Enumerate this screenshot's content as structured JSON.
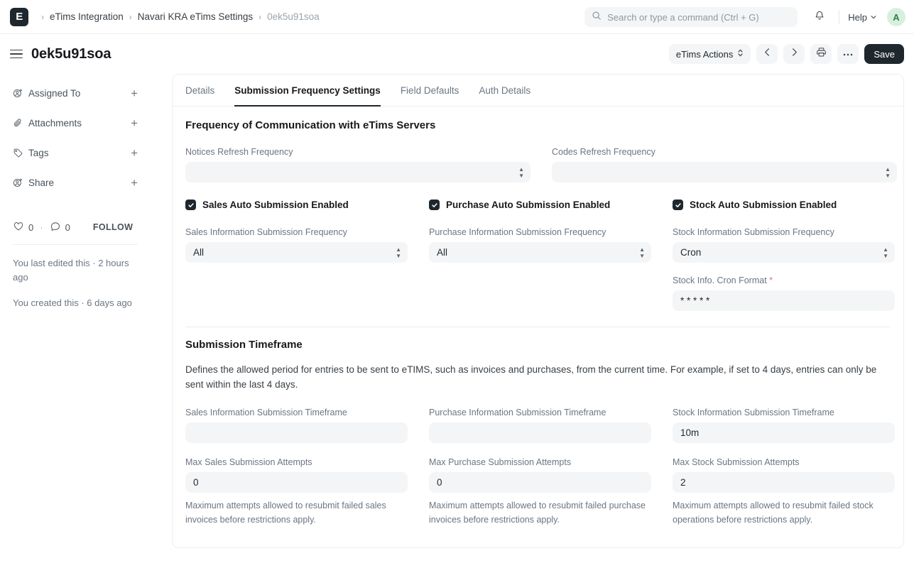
{
  "navbar": {
    "logo_text": "E",
    "breadcrumbs": [
      {
        "label": "eTims Integration",
        "muted": false
      },
      {
        "label": "Navari KRA eTims Settings",
        "muted": false
      },
      {
        "label": "0ek5u91soa",
        "muted": true
      }
    ],
    "search": {
      "placeholder": "Search or type a command (Ctrl + G)",
      "value": ""
    },
    "notifications_icon": "bell-icon",
    "help_label": "Help",
    "avatar_initial": "A"
  },
  "page_head": {
    "title": "0ek5u91soa",
    "actions_dropdown": "eTims Actions",
    "prev_icon": "chevron-left-icon",
    "next_icon": "chevron-right-icon",
    "print_icon": "printer-icon",
    "more_icon": "ellipsis-icon",
    "save_label": "Save"
  },
  "sidebar": {
    "items": [
      {
        "label": "Assigned To",
        "icon": "user-plus-icon",
        "add": "+"
      },
      {
        "label": "Attachments",
        "icon": "paperclip-icon",
        "add": "+"
      },
      {
        "label": "Tags",
        "icon": "tag-icon",
        "add": "+"
      },
      {
        "label": "Share",
        "icon": "user-plus-icon",
        "add": "+"
      }
    ],
    "likes_count": "0",
    "separator_dot": "·",
    "comments_count": "0",
    "follow_label": "FOLLOW",
    "edited_note": "You last edited this · 2 hours ago",
    "created_note": "You created this · 6 days ago"
  },
  "tabs": [
    {
      "label": "Details",
      "active": false
    },
    {
      "label": "Submission Frequency Settings",
      "active": true
    },
    {
      "label": "Field Defaults",
      "active": false
    },
    {
      "label": "Auth Details",
      "active": false
    }
  ],
  "frequency_section": {
    "title": "Frequency of Communication with eTims Servers",
    "notices_refresh": {
      "label": "Notices Refresh Frequency",
      "value": ""
    },
    "codes_refresh": {
      "label": "Codes Refresh Frequency",
      "value": ""
    },
    "columns": [
      {
        "checkbox_label": "Sales Auto Submission Enabled",
        "checked": true,
        "freq_label": "Sales Information Submission Frequency",
        "freq_value": "All"
      },
      {
        "checkbox_label": "Purchase Auto Submission Enabled",
        "checked": true,
        "freq_label": "Purchase Information Submission Frequency",
        "freq_value": "All"
      },
      {
        "checkbox_label": "Stock Auto Submission Enabled",
        "checked": true,
        "freq_label": "Stock Information Submission Frequency",
        "freq_value": "Cron"
      }
    ],
    "cron": {
      "label": "Stock Info. Cron Format",
      "required_marker": "*",
      "value": "* * * * *"
    }
  },
  "timeframe_section": {
    "title": "Submission Timeframe",
    "description": "Defines the allowed period for entries to be sent to eTIMS, such as invoices and purchases, from the current time. For example, if set to 4 days, entries can only be sent within the last 4 days.",
    "timeframes": [
      {
        "label": "Sales Information Submission Timeframe",
        "value": ""
      },
      {
        "label": "Purchase Information Submission Timeframe",
        "value": ""
      },
      {
        "label": "Stock Information Submission Timeframe",
        "value": "10m"
      }
    ],
    "attempts": [
      {
        "label": "Max Sales Submission Attempts",
        "value": "0",
        "help": "Maximum attempts allowed to resubmit failed sales invoices before restrictions apply."
      },
      {
        "label": "Max Purchase Submission Attempts",
        "value": "0",
        "help": "Maximum attempts allowed to resubmit failed purchase invoices before restrictions apply."
      },
      {
        "label": "Max Stock Submission Attempts",
        "value": "2",
        "help": "Maximum attempts allowed to resubmit failed stock operations before restrictions apply."
      }
    ]
  },
  "colors": {
    "accent_dark": "#1f272e",
    "field_bg": "#f4f5f6",
    "border": "#ebeef0",
    "muted_text": "#6b7682",
    "required_red": "#e57373",
    "avatar_bg": "#d7f0de"
  }
}
